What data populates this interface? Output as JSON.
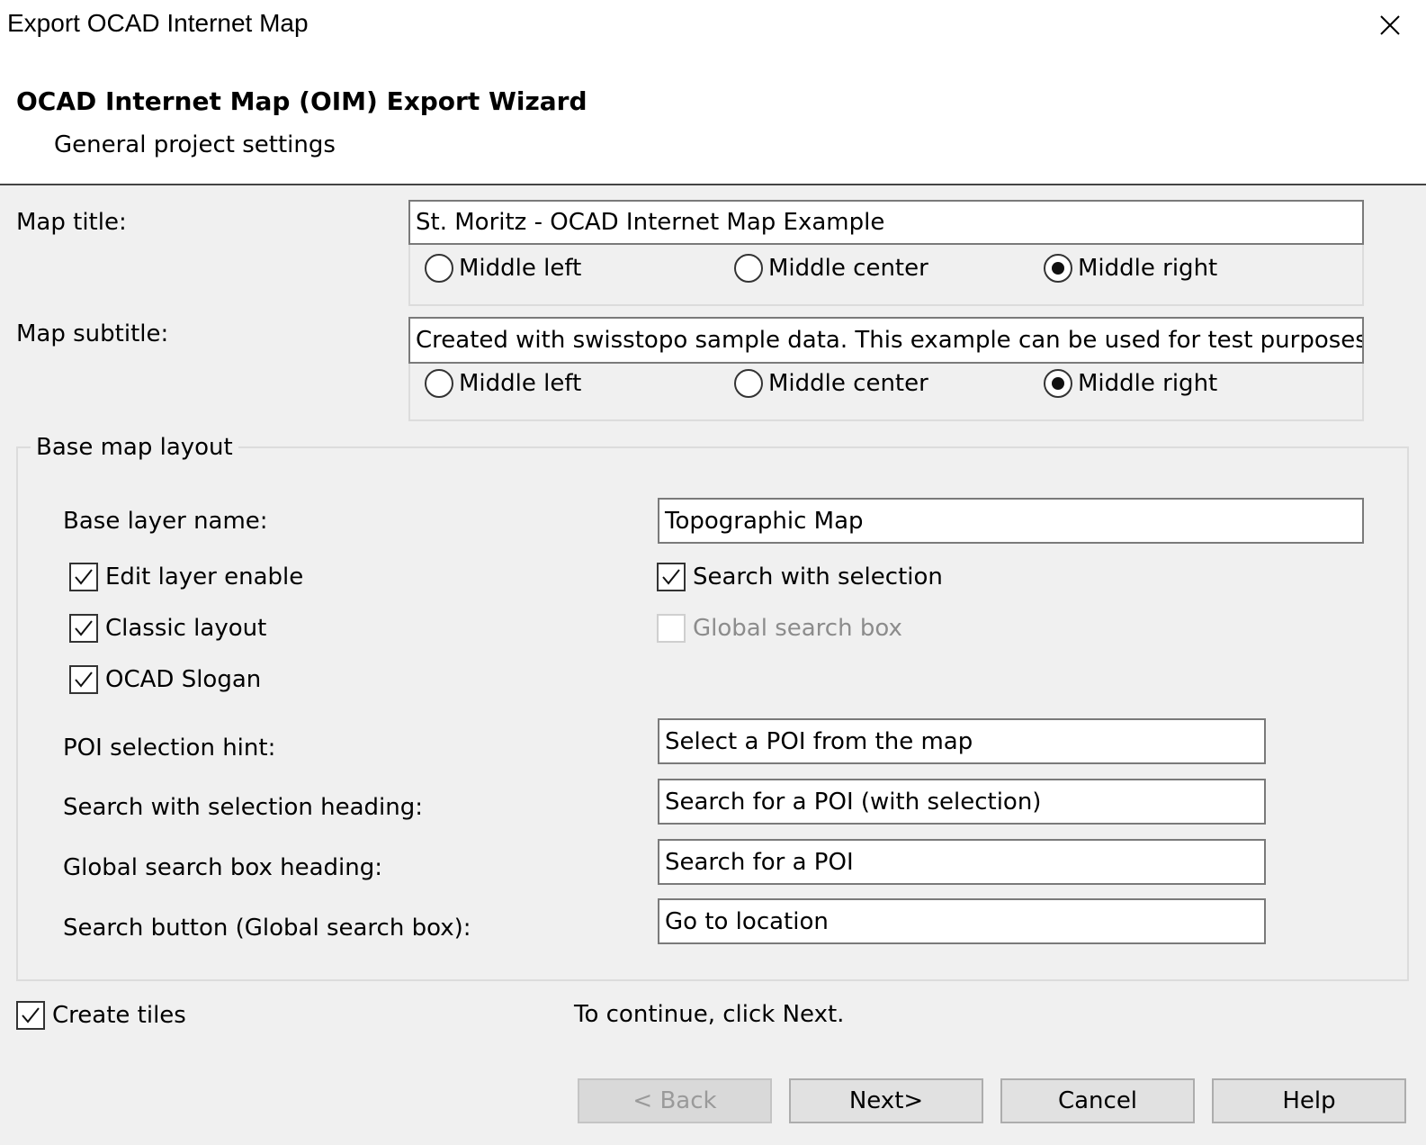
{
  "window": {
    "title": "Export OCAD Internet Map",
    "close_icon": "close-icon"
  },
  "header": {
    "title": "OCAD Internet Map (OIM) Export Wizard",
    "subtitle": "General project settings"
  },
  "map_title": {
    "label": "Map title:",
    "value": "St. Moritz - OCAD Internet Map Example",
    "alignment_options": [
      "Middle left",
      "Middle center",
      "Middle right"
    ],
    "selected": "Middle right"
  },
  "map_subtitle": {
    "label": "Map subtitle:",
    "value": "Created with swisstopo sample data. This example can be used for test purposes o",
    "alignment_options": [
      "Middle left",
      "Middle center",
      "Middle right"
    ],
    "selected": "Middle right"
  },
  "base_map_layout": {
    "legend": "Base map layout",
    "base_layer_name_label": "Base layer name:",
    "base_layer_name_value": "Topographic Map",
    "edit_layer_enable": {
      "label": "Edit layer enable",
      "checked": true
    },
    "classic_layout": {
      "label": "Classic layout",
      "checked": true
    },
    "ocad_slogan": {
      "label": "OCAD Slogan",
      "checked": true
    },
    "search_with_selection": {
      "label": "Search with selection",
      "checked": true
    },
    "global_search_box": {
      "label": "Global search box",
      "checked": false,
      "enabled": false
    },
    "poi_selection_hint_label": "POI selection hint:",
    "poi_selection_hint_value": "Select a POI from the map",
    "search_with_selection_heading_label": "Search with selection heading:",
    "search_with_selection_heading_value": "Search for a POI (with selection)",
    "global_search_box_heading_label": "Global search box heading:",
    "global_search_box_heading_value": "Search for a POI",
    "search_button_label": "Search button (Global search box):",
    "search_button_value": "Go to location"
  },
  "create_tiles": {
    "label": "Create tiles",
    "checked": true
  },
  "continue_hint": "To continue, click Next.",
  "buttons": {
    "back": "< Back",
    "next": "Next>",
    "cancel": "Cancel",
    "help": "Help"
  }
}
